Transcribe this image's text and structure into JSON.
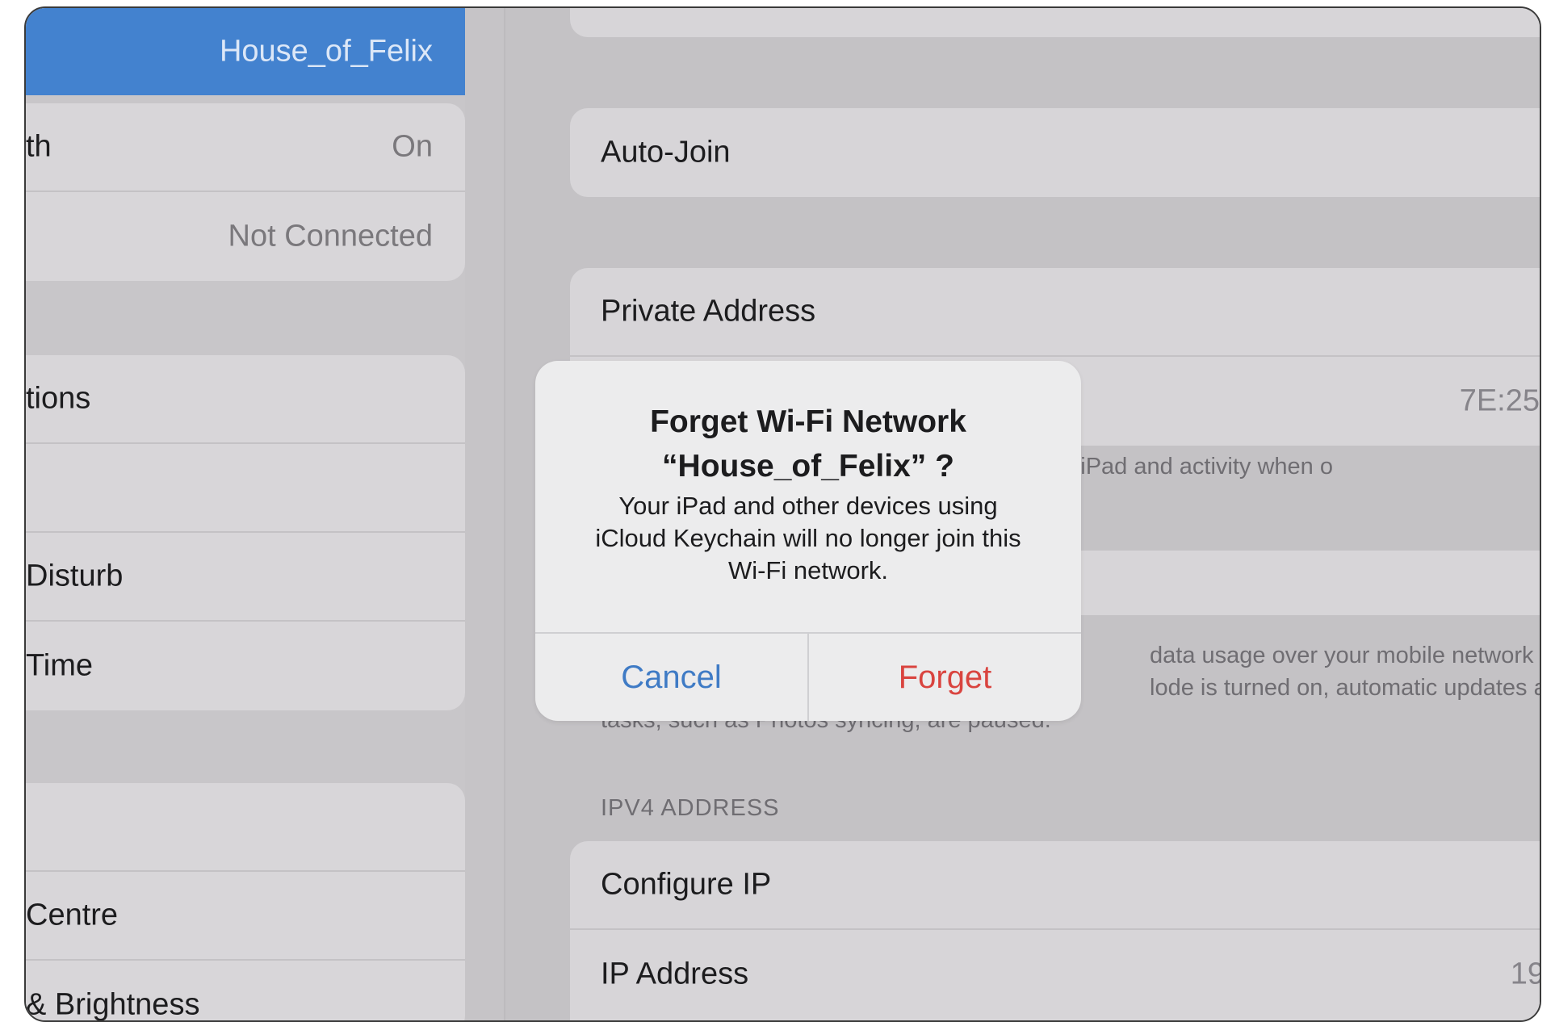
{
  "sidebar": {
    "selected_network": "House_of_Felix",
    "items_group1": [
      {
        "label": "th",
        "value": "On"
      },
      {
        "label": "",
        "value": "Not Connected"
      }
    ],
    "items_group2": [
      {
        "label": "tions",
        "value": ""
      },
      {
        "label": "",
        "value": ""
      },
      {
        "label": "Disturb",
        "value": ""
      },
      {
        "label": "Time",
        "value": ""
      }
    ],
    "items_group3": [
      {
        "label": "",
        "value": ""
      },
      {
        "label": "Centre",
        "value": ""
      },
      {
        "label": "& Brightness",
        "value": ""
      }
    ]
  },
  "detail": {
    "auto_join_label": "Auto-Join",
    "private_address_label": "Private Address",
    "wifi_address_value": "7E:25",
    "private_footer": "racking of your iPad and activity when o",
    "low_data_footer_line1": "data usage over your mobile network o",
    "low_data_footer_line2": "lode is turned on, automatic updates an",
    "low_data_footer_line3": "tasks, such as Photos syncing, are paused.",
    "ipv4_header": "IPV4 ADDRESS",
    "configure_ip_label": "Configure IP",
    "ip_address_label": "IP Address",
    "ip_address_value": "19"
  },
  "alert": {
    "title_line1": "Forget Wi-Fi Network",
    "title_line2": "“House_of_Felix” ?",
    "message_line1": "Your iPad and other devices using",
    "message_line2": "iCloud Keychain will no longer join this",
    "message_line3": "Wi-Fi network.",
    "cancel_label": "Cancel",
    "forget_label": "Forget"
  },
  "colors": {
    "selected_bg": "#4382cf",
    "cancel_text": "#3f7bc5",
    "forget_text": "#d9443f"
  }
}
